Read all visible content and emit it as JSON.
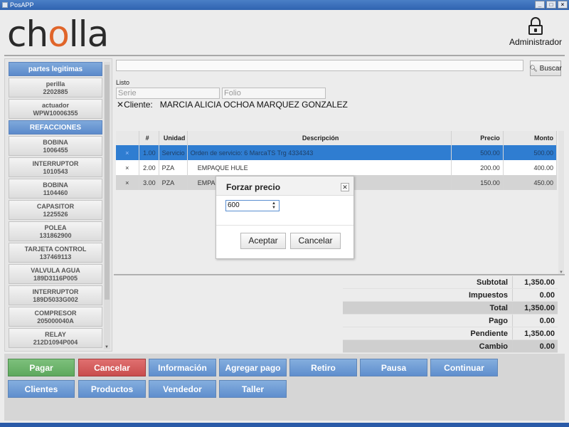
{
  "window": {
    "title": "PosAPP",
    "buttons": [
      "_",
      "□",
      "×"
    ]
  },
  "header": {
    "logo_prefix": "ch",
    "logo_o": "o",
    "logo_suffix": "lla",
    "user": "Administrador"
  },
  "sidebar": {
    "groups": [
      {
        "header": "partes legitimas",
        "items": [
          {
            "name": "perilla",
            "code": "2202885"
          },
          {
            "name": "actuador",
            "code": "WPW10006355"
          }
        ]
      },
      {
        "header": "REFACCIONES",
        "items": [
          {
            "name": "BOBINA",
            "code": "1006455"
          },
          {
            "name": "INTERRUPTOR",
            "code": "1010543"
          },
          {
            "name": "BOBINA",
            "code": "1104460"
          },
          {
            "name": "CAPASITOR",
            "code": "1225526"
          },
          {
            "name": "POLEA",
            "code": "131862900"
          },
          {
            "name": "TARJETA CONTROL",
            "code": "137469113"
          },
          {
            "name": "VALVULA AGUA",
            "code": "189D3116P005"
          },
          {
            "name": "INTERRUPTOR",
            "code": "189D5033G002"
          },
          {
            "name": "COMPRESOR",
            "code": "205000040A"
          },
          {
            "name": "RELAY",
            "code": "212D1094P004"
          }
        ]
      }
    ]
  },
  "search": {
    "value": "",
    "button_label": "Buscar"
  },
  "order": {
    "status": "Listo",
    "serie_placeholder": "Serie",
    "folio_placeholder": "Folio",
    "cliente_label": "Cliente:",
    "cliente_name": "MARCIA ALICIA OCHOA MARQUEZ GONZALEZ"
  },
  "table": {
    "headers": {
      "num": "#",
      "unidad": "Unidad",
      "descripcion": "Descripción",
      "precio": "Precio",
      "monto": "Monto"
    },
    "rows": [
      {
        "x": "×",
        "num": "1.00",
        "unidad": "Servicio",
        "descripcion": "Orden de servicio: 6 MarcaTS Trg 4334343",
        "precio": "500.00",
        "monto": "500.00"
      },
      {
        "x": "×",
        "num": "2.00",
        "unidad": "PZA",
        "descripcion": "    EMPAQUE HULE",
        "precio": "200.00",
        "monto": "400.00"
      },
      {
        "x": "×",
        "num": "3.00",
        "unidad": "PZA",
        "descripcion": "    EMPAQ",
        "precio": "150.00",
        "monto": "450.00"
      }
    ]
  },
  "totals": {
    "subtotal": {
      "label": "Subtotal",
      "value": "1,350.00"
    },
    "impuestos": {
      "label": "Impuestos",
      "value": "0.00"
    },
    "total": {
      "label": "Total",
      "value": "1,350.00"
    },
    "pago": {
      "label": "Pago",
      "value": "0.00"
    },
    "pendiente": {
      "label": "Pendiente",
      "value": "1,350.00"
    },
    "cambio": {
      "label": "Cambio",
      "value": "0.00"
    }
  },
  "actions": {
    "pagar": "Pagar",
    "cancelar": "Cancelar",
    "informacion": "Información",
    "agregar_pago": "Agregar pago",
    "retiro": "Retiro",
    "pausa": "Pausa",
    "continuar": "Continuar",
    "clientes": "Clientes",
    "productos": "Productos",
    "vendedor": "Vendedor",
    "taller": "Taller"
  },
  "modal": {
    "title": "Forzar precio",
    "value": "600",
    "ok_label": "Aceptar",
    "cancel_label": "Cancelar"
  },
  "colors": {
    "accent_blue": "#6a97d2",
    "pay_green": "#6bb36a",
    "cancel_red": "#d45c5c",
    "logo_orange": "#e0652a",
    "row_selected": "#2f7dd1"
  }
}
